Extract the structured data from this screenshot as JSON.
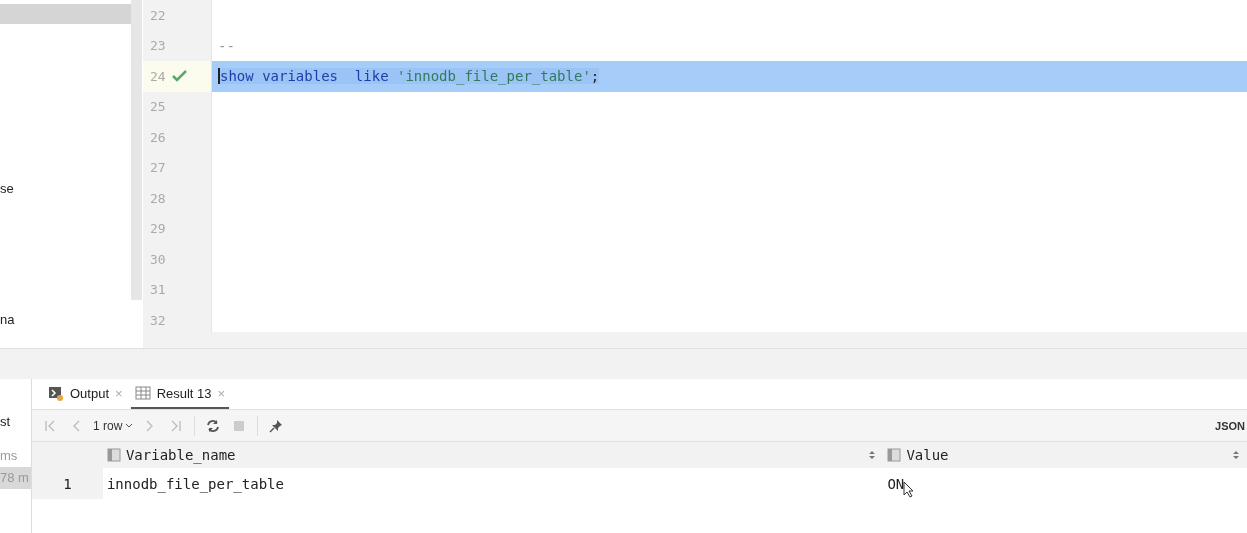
{
  "sidebar": {
    "items": [
      {
        "selected": true
      },
      {
        "label": "se",
        "selected": false
      },
      {
        "label": "na",
        "selected": false
      }
    ]
  },
  "editor": {
    "lines": [
      {
        "number": "22",
        "verified": false,
        "selected": false
      },
      {
        "number": "23",
        "verified": false,
        "selected": false,
        "tokens": [
          {
            "text": "--",
            "kind": "comment"
          }
        ]
      },
      {
        "number": "24",
        "verified": true,
        "selected": true,
        "tokens": [
          {
            "text": "show variables  like",
            "kind": "keyword"
          },
          {
            "text": "'innodb_file_per_table'",
            "kind": "string"
          },
          {
            "text": ";",
            "kind": "plain"
          }
        ]
      },
      {
        "number": "25",
        "verified": false,
        "selected": false
      },
      {
        "number": "26",
        "verified": false,
        "selected": false
      },
      {
        "number": "27",
        "verified": false,
        "selected": false
      },
      {
        "number": "28",
        "verified": false,
        "selected": false
      },
      {
        "number": "29",
        "verified": false,
        "selected": false
      },
      {
        "number": "30",
        "verified": false,
        "selected": false
      },
      {
        "number": "31",
        "verified": false,
        "selected": false
      },
      {
        "number": "32",
        "verified": false,
        "selected": false
      }
    ]
  },
  "services": {
    "items": [
      {
        "label": "st",
        "selected": false
      },
      {
        "label": "ms",
        "selected": false
      },
      {
        "label": "78 m",
        "selected": true
      }
    ]
  },
  "tabs": [
    {
      "label": "Output",
      "kind": "output",
      "close": "×",
      "selected": false
    },
    {
      "label": "Result 13",
      "kind": "result",
      "close": "×",
      "selected": true
    }
  ],
  "toolbar": [
    {
      "kind": "first",
      "disabled": true
    },
    {
      "kind": "prev",
      "disabled": true
    },
    {
      "kind": "rows",
      "label": "1 row",
      "disabled": false
    },
    {
      "kind": "next",
      "disabled": true
    },
    {
      "kind": "last",
      "disabled": true
    },
    {
      "kind": "sep"
    },
    {
      "kind": "refresh",
      "disabled": false
    },
    {
      "kind": "stop",
      "disabled": true
    },
    {
      "kind": "sep"
    },
    {
      "kind": "pin",
      "disabled": false
    }
  ],
  "format": "JSON",
  "table": {
    "columns": [
      "Variable_name",
      "Value"
    ],
    "rows": [
      {
        "number": "1",
        "cells": [
          "innodb_file_per_table",
          "ON"
        ]
      }
    ]
  }
}
